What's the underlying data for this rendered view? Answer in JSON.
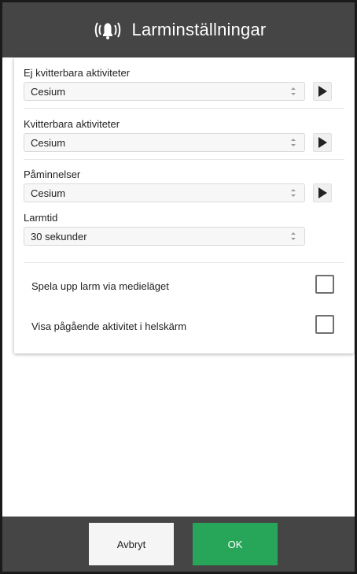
{
  "header": {
    "title": "Larminställningar",
    "icon": "alarm-bell-icon"
  },
  "settings": {
    "ej_kvitterbara": {
      "label": "Ej kvitterbara aktiviteter",
      "value": "Cesium"
    },
    "kvitterbara": {
      "label": "Kvitterbara aktiviteter",
      "value": "Cesium"
    },
    "paminnelser": {
      "label": "Påminnelser",
      "value": "Cesium"
    },
    "larmtid": {
      "label": "Larmtid",
      "value": "30 sekunder"
    },
    "checkboxes": [
      {
        "label": "Spela upp larm via medieläget",
        "checked": false
      },
      {
        "label": "Visa pågående aktivitet i helskärm",
        "checked": false
      }
    ]
  },
  "footer": {
    "cancel_label": "Avbryt",
    "ok_label": "OK"
  },
  "colors": {
    "header_bg": "#454545",
    "ok_bg": "#27a65a",
    "cancel_bg": "#f5f5f5"
  }
}
